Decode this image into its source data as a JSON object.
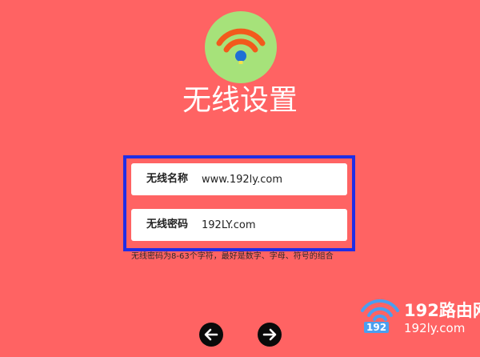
{
  "header": {
    "icon": "wifi-icon",
    "title": "无线设置"
  },
  "form": {
    "ssid": {
      "label": "无线名称",
      "value": "www.192ly.com"
    },
    "password": {
      "label": "无线密码",
      "value": "192LY.com"
    },
    "hint": "无线密码为8-63个字符，最好是数字、字母、符号的组合"
  },
  "navigation": {
    "back_icon": "arrow-left-icon",
    "next_icon": "arrow-right-icon"
  },
  "watermark": {
    "brand": "192路由网",
    "number": "192",
    "url": "192ly.com"
  },
  "colors": {
    "background": "#ff6363",
    "badge": "#a6e27a",
    "wifi_arc": "#f25a1c",
    "wifi_dot": "#1f6fd6",
    "frame": "#1f2ee6"
  }
}
